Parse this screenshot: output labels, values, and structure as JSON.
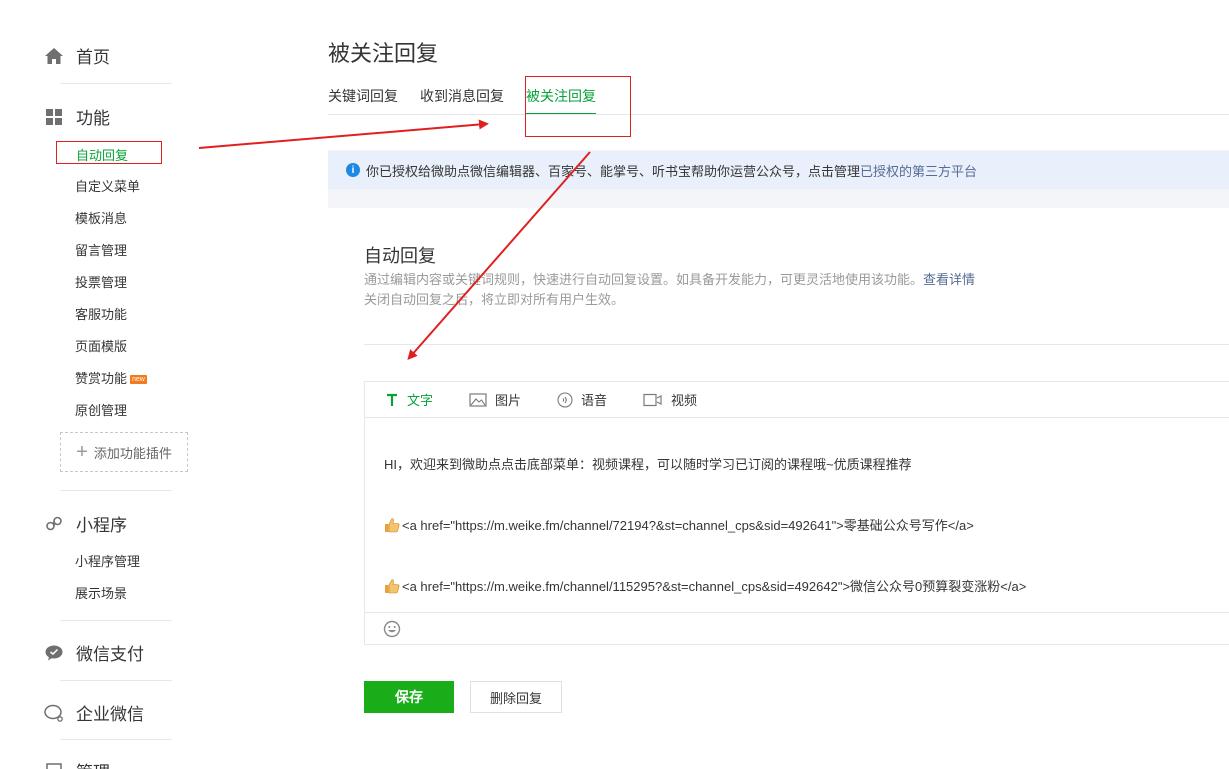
{
  "sidebar": {
    "home": "首页",
    "features": "功能",
    "feature_items": [
      "自动回复",
      "自定义菜单",
      "模板消息",
      "留言管理",
      "投票管理",
      "客服功能",
      "页面模版",
      "赞赏功能",
      "原创管理"
    ],
    "new_badge": "new",
    "add_plugin": "添加功能插件",
    "miniprogram": "小程序",
    "miniprogram_items": [
      "小程序管理",
      "展示场景"
    ],
    "wechat_pay": "微信支付",
    "enterprise": "企业微信",
    "manage": "管理"
  },
  "page": {
    "title": "被关注回复",
    "tabs": [
      "关键词回复",
      "收到消息回复",
      "被关注回复"
    ]
  },
  "notice": {
    "text": "你已授权给微助点微信编辑器、百家号、能掌号、听书宝帮助你运营公众号，点击管理",
    "link": "已授权的第三方平台"
  },
  "card": {
    "title": "自动回复",
    "desc_line1": "通过编辑内容或关键词规则，快速进行自动回复设置。如具备开发能力，可更灵活地使用该功能。",
    "desc_link": "查看详情",
    "desc_line2": "关闭自动回复之后，将立即对所有用户生效。"
  },
  "editor": {
    "tabs": [
      "文字",
      "图片",
      "语音",
      "视频"
    ],
    "line1": "HI，欢迎来到微助点点击底部菜单：视频课程，可以随时学习已订阅的课程哦~优质课程推荐",
    "line2": "<a href=\"https://m.weike.fm/channel/72194?&st=channel_cps&sid=492641\">零基础公众号写作</a>",
    "line3": "<a href=\"https://m.weike.fm/channel/115295?&st=channel_cps&sid=492642\">微信公众号0预算裂变涨粉</a>"
  },
  "buttons": {
    "save": "保存",
    "delete": "删除回复"
  },
  "colors": {
    "accent_green": "#07a23a",
    "save_green": "#1aad19",
    "annotation_red": "#e02020",
    "link_blue": "#576b95"
  }
}
